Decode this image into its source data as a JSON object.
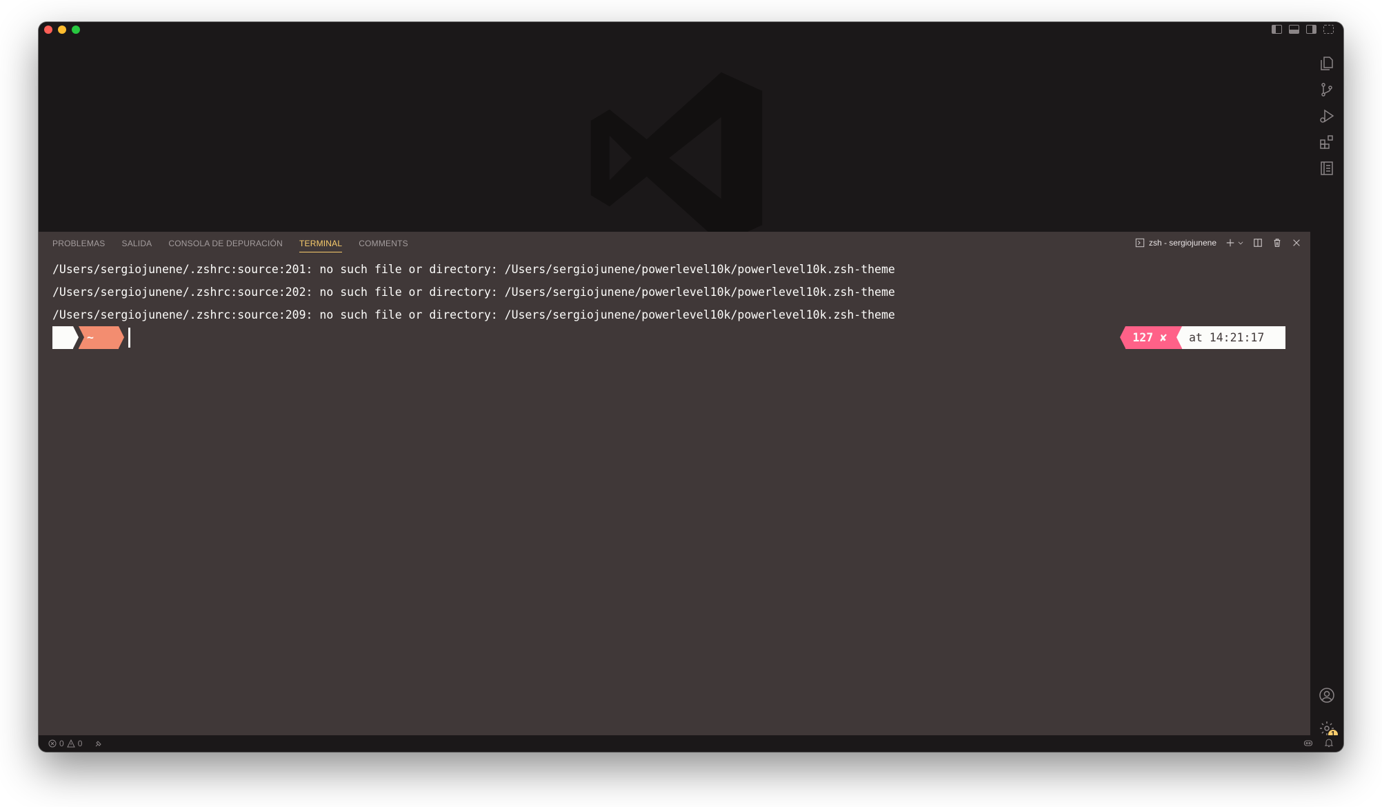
{
  "panel": {
    "tabs": [
      {
        "label": "PROBLEMAS"
      },
      {
        "label": "SALIDA"
      },
      {
        "label": "CONSOLA DE DEPURACIÓN"
      },
      {
        "label": "TERMINAL"
      },
      {
        "label": "COMMENTS"
      }
    ],
    "active_tab": "TERMINAL",
    "terminal_name": "zsh - sergiojunene"
  },
  "terminal": {
    "lines": [
      "/Users/sergiojunene/.zshrc:source:201: no such file or directory: /Users/sergiojunene/powerlevel10k/powerlevel10k.zsh-theme",
      "/Users/sergiojunene/.zshrc:source:202: no such file or directory: /Users/sergiojunene/powerlevel10k/powerlevel10k.zsh-theme",
      "/Users/sergiojunene/.zshrc:source:209: no such file or directory: /Users/sergiojunene/powerlevel10k/powerlevel10k.zsh-theme"
    ],
    "prompt": {
      "os_glyph": "",
      "dir_text": " ~",
      "status_text": "127 ✘",
      "time_text": "at 14:21:17 "
    }
  },
  "statusbar": {
    "errors": "0",
    "warnings": "0",
    "settings_badge": "1"
  },
  "colors": {
    "accent": "#f9cc6c",
    "prompt_dir": "#f38d70",
    "prompt_error": "#ff6188",
    "panel_bg": "#403838",
    "chrome_bg": "#1b1819"
  },
  "icons": {
    "activity": [
      "explorer-icon",
      "source-control-icon",
      "run-debug-icon",
      "extensions-icon",
      "notebook-icon"
    ],
    "bottom": [
      "account-icon",
      "settings-gear-icon"
    ]
  }
}
